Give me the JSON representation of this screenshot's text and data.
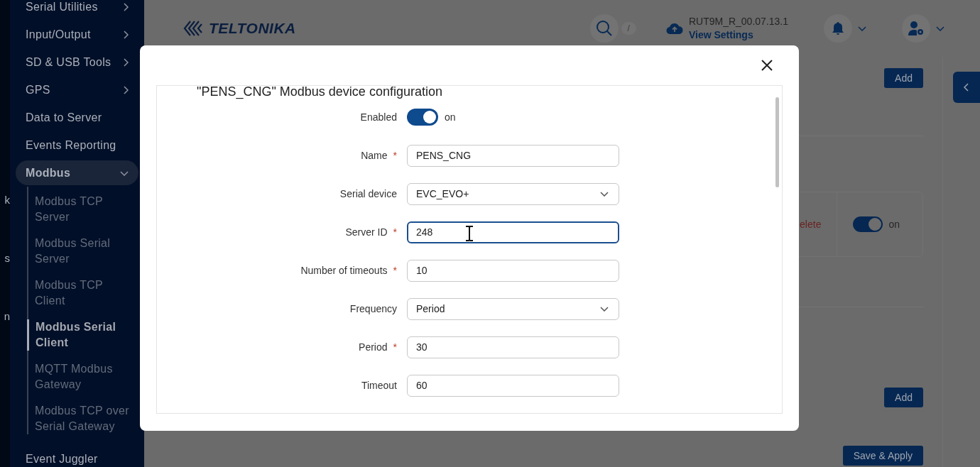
{
  "sidebar": {
    "edge_fragments": [
      "k",
      "s",
      "n"
    ],
    "items": [
      {
        "label": "Serial Utilities",
        "expandable": true,
        "expanded": false
      },
      {
        "label": "Input/Output",
        "expandable": true,
        "expanded": false
      },
      {
        "label": "SD & USB Tools",
        "expandable": true,
        "expanded": false
      },
      {
        "label": "GPS",
        "expandable": true,
        "expanded": false
      },
      {
        "label": "Data to Server",
        "expandable": false,
        "expanded": false
      },
      {
        "label": "Events Reporting",
        "expandable": false,
        "expanded": false
      },
      {
        "label": "Modbus",
        "expandable": true,
        "expanded": true,
        "children": [
          {
            "label": "Modbus TCP Server",
            "selected": false
          },
          {
            "label": "Modbus Serial Server",
            "selected": false
          },
          {
            "label": "Modbus TCP Client",
            "selected": false
          },
          {
            "label": "Modbus Serial Client",
            "selected": true
          },
          {
            "label": "MQTT Modbus Gateway",
            "selected": false
          },
          {
            "label": "Modbus TCP over Serial Gateway",
            "selected": false
          }
        ]
      },
      {
        "label": "Event Juggler",
        "expandable": false,
        "expanded": false
      }
    ]
  },
  "header": {
    "logo": "TELTONIKA",
    "search_shortcut": "/",
    "firmware": "RUT9M_R_00.07.13.1",
    "settings_link": "View Settings"
  },
  "background": {
    "add_buttons": [
      "Add",
      "Add"
    ],
    "delete_link": "elete",
    "toggle": {
      "on": true,
      "label": "on"
    },
    "save_button": "Save & Apply"
  },
  "dialog": {
    "title": "\"PENS_CNG\" Modbus device configuration",
    "fields": [
      {
        "kind": "toggle",
        "label": "Enabled",
        "on": true,
        "value": "on"
      },
      {
        "kind": "text",
        "label": "Name",
        "required_mark": "*",
        "value": "PENS_CNG",
        "focused": false
      },
      {
        "kind": "select",
        "label": "Serial device",
        "value": "EVC_EVO+",
        "focused": false
      },
      {
        "kind": "text",
        "label": "Server ID",
        "required_mark": "*",
        "value": "248",
        "focused": true
      },
      {
        "kind": "text",
        "label": "Number of timeouts",
        "required_mark": "*",
        "value": "10",
        "focused": false
      },
      {
        "kind": "select",
        "label": "Frequency",
        "value": "Period",
        "focused": false
      },
      {
        "kind": "text",
        "label": "Period",
        "required_mark": "*",
        "value": "30",
        "focused": false
      },
      {
        "kind": "text",
        "label": "Timeout",
        "value": "60",
        "focused": false
      }
    ]
  }
}
